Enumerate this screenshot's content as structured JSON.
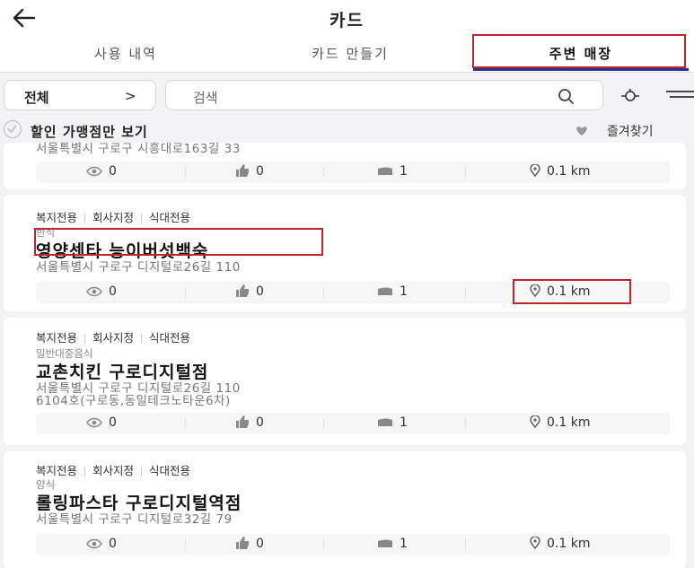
{
  "header": {
    "title": "카드"
  },
  "tabs": [
    {
      "label": "사용 내역"
    },
    {
      "label": "카드 만들기"
    },
    {
      "label": "주변 매장"
    }
  ],
  "filter": {
    "category": "전체",
    "chevron": ">",
    "search_placeholder": "검색"
  },
  "discount": {
    "label": "할인 가맹점만 보기",
    "favorites_label": "즐겨찾기"
  },
  "partial_card": {
    "address": "서울특별시 구로구 시흥대로163길 33"
  },
  "stores": [
    {
      "tags": [
        "복지전용",
        "회사지정",
        "식대전용"
      ],
      "category": "한식",
      "name": "영양센타 능이버섯백숙",
      "address_lines": [
        "서울특별시 구로구 디지털로26길 110"
      ]
    },
    {
      "tags": [
        "복지전용",
        "회사지정",
        "식대전용"
      ],
      "category": "일반대중음식",
      "name": "교촌치킨 구로디지털점",
      "address_lines": [
        "서울특별시 구로구 디지털로26길 110",
        "6104호(구로동,동일테크노타운6차)"
      ]
    },
    {
      "tags": [
        "복지전용",
        "회사지정",
        "식대전용"
      ],
      "category": "양식",
      "name": "롤링파스타 구로디지털역점",
      "address_lines": [
        "서울특별시 구로구 디지털로32길 79"
      ]
    }
  ],
  "stats": {
    "views": "0",
    "likes": "0",
    "reviews": "1",
    "distance": "0.1 km"
  },
  "colors": {
    "highlight": "#c0242f",
    "tab_underline": "#2f2f8a"
  }
}
